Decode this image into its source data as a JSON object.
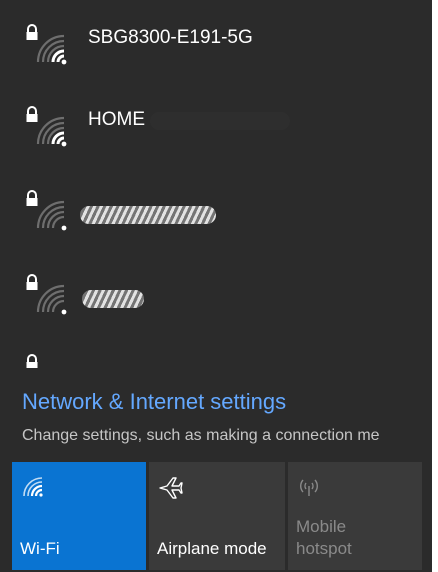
{
  "networks": [
    {
      "ssid": "SBG8300-E191-5G",
      "signal": "strong",
      "secured": true,
      "redacted": false
    },
    {
      "ssid": "HOME",
      "signal": "strong",
      "secured": true,
      "redacted": false
    },
    {
      "ssid": "",
      "signal": "weak",
      "secured": true,
      "redacted": true
    },
    {
      "ssid": "",
      "signal": "weak",
      "secured": true,
      "redacted": true
    }
  ],
  "settings": {
    "link_label": "Network & Internet settings",
    "description": "Change settings, such as making a connection me"
  },
  "quick_actions": {
    "wifi_label": "Wi-Fi",
    "airplane_label": "Airplane mode",
    "hotspot_label_line1": "Mobile",
    "hotspot_label_line2": "hotspot"
  },
  "colors": {
    "background": "#2b2b2b",
    "accent": "#0a74d2",
    "link": "#64a8ff",
    "tile_inactive": "#3a3a3a"
  },
  "icons": [
    "lock-icon",
    "wifi-signal-icon",
    "airplane-icon",
    "mobile-hotspot-icon"
  ]
}
